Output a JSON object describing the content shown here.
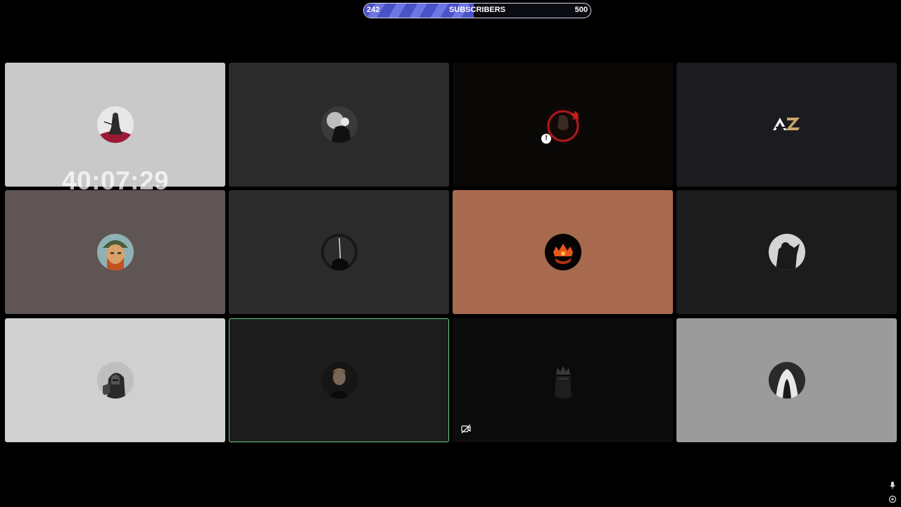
{
  "goal": {
    "current": "242",
    "label": "SUBSCRIBERS",
    "target": "500",
    "progress_fraction": 0.484
  },
  "timer": "40:07:29",
  "tiles": [
    {
      "bg": "#c9c9c9",
      "avatar": "samurai-ink-avatar"
    },
    {
      "bg": "#2b2b2b",
      "avatar": "grayscale-figure-avatar"
    },
    {
      "bg": "#0a0807",
      "avatar": "red-ring-star-avatar"
    },
    {
      "bg": "#1c1c20",
      "avatar": "az-logo"
    },
    {
      "bg": "#5f5554",
      "avatar": "van-gogh-portrait-avatar"
    },
    {
      "bg": "#2b2b2b",
      "avatar": "dark-silhouette-avatar"
    },
    {
      "bg": "#a86a4f",
      "avatar": "fire-crown-avatar"
    },
    {
      "bg": "#1c1c1c",
      "avatar": "shadow-figure-avatar"
    },
    {
      "bg": "#d0d0d0",
      "avatar": "armored-knight-avatar"
    },
    {
      "bg": "#1c1c1c",
      "avatar": "man-portrait-avatar",
      "active": true
    },
    {
      "bg": "#0c0c0c",
      "avatar": "dark-king-avatar"
    },
    {
      "bg": "#9b9b9b",
      "avatar": "white-hair-figure-avatar"
    }
  ],
  "logo_text": "AZ"
}
